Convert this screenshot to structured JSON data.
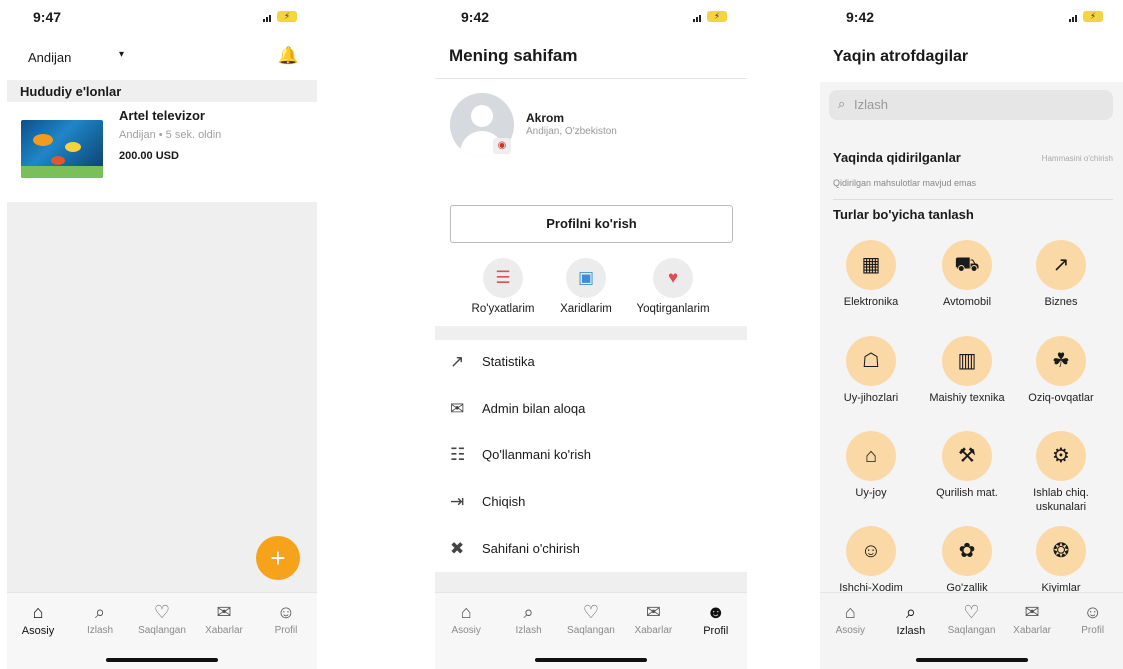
{
  "screen1": {
    "status": {
      "time": "9:47"
    },
    "header": {
      "location": "Andijan",
      "caret": "▾",
      "bell": "🔔"
    },
    "section_title": "Hududiy e'lonlar",
    "listing": {
      "title": "Artel televizor",
      "meta": "Andijan • 5 sek. oldin",
      "price": "200.00 USD"
    },
    "fab": "+",
    "nav": [
      {
        "label": "Asosiy",
        "icon": "⌂"
      },
      {
        "label": "Izlash",
        "icon": "⌕"
      },
      {
        "label": "Saqlangan",
        "icon": "♡"
      },
      {
        "label": "Xabarlar",
        "icon": "✉"
      },
      {
        "label": "Profil",
        "icon": "☺"
      }
    ],
    "nav_active": "Asosiy"
  },
  "screen2": {
    "status": {
      "time": "9:42"
    },
    "title": "Mening sahifam",
    "user": {
      "name": "Akrom",
      "location": "Andijan, O'zbekiston"
    },
    "camera": "◉",
    "profile_button": "Profilni ko'rish",
    "quick_actions": [
      {
        "label": "Ro'yxatlarim",
        "icon": "☰"
      },
      {
        "label": "Xaridlarim",
        "icon": "▣"
      },
      {
        "label": "Yoqtirganlarim",
        "icon": "♥"
      }
    ],
    "menu": [
      {
        "label": "Statistika",
        "icon": "↗"
      },
      {
        "label": "Admin bilan aloqa",
        "icon": "✉"
      },
      {
        "label": "Qo'llanmani ko'rish",
        "icon": "☷"
      },
      {
        "label": "Chiqish",
        "icon": "⇥"
      },
      {
        "label": "Sahifani o'chirish",
        "icon": "✖"
      }
    ],
    "nav": [
      {
        "label": "Asosiy",
        "icon": "⌂"
      },
      {
        "label": "Izlash",
        "icon": "⌕"
      },
      {
        "label": "Saqlangan",
        "icon": "♡"
      },
      {
        "label": "Xabarlar",
        "icon": "✉"
      },
      {
        "label": "Profil",
        "icon": "☻"
      }
    ],
    "nav_active": "Profil"
  },
  "screen3": {
    "status": {
      "time": "9:42"
    },
    "title": "Yaqin atrofdagilar",
    "search": {
      "placeholder": "Izlash",
      "icon": "⌕"
    },
    "recent_title": "Yaqinda qidirilganlar",
    "see_all": "Hammasini o'chirish",
    "empty_text": "Qidirilgan mahsulotlar mavjud emas",
    "categories_title": "Turlar bo'yicha tanlash",
    "categories": [
      {
        "label": "Elektronika",
        "icon": "▦"
      },
      {
        "label": "Avtomobil",
        "icon": "⛟"
      },
      {
        "label": "Biznes",
        "icon": "↗"
      },
      {
        "label": "Uy-jihozlari",
        "icon": "☖"
      },
      {
        "label": "Maishiy texnika",
        "icon": "▥"
      },
      {
        "label": "Oziq-ovqatlar",
        "icon": "☘"
      },
      {
        "label": "Uy-joy",
        "icon": "⌂"
      },
      {
        "label": "Qurilish mat.",
        "icon": "⚒"
      },
      {
        "label": "Ishlab chiq. uskunalari",
        "icon": "⚙"
      },
      {
        "label": "Ishchi-Xodim",
        "icon": "☺"
      },
      {
        "label": "Go'zallik",
        "icon": "✿"
      },
      {
        "label": "Kiyimlar",
        "icon": "❂"
      }
    ],
    "nav": [
      {
        "label": "Asosiy",
        "icon": "⌂"
      },
      {
        "label": "Izlash",
        "icon": "⌕"
      },
      {
        "label": "Saqlangan",
        "icon": "♡"
      },
      {
        "label": "Xabarlar",
        "icon": "✉"
      },
      {
        "label": "Profil",
        "icon": "☺"
      }
    ],
    "nav_active": "Izlash"
  }
}
